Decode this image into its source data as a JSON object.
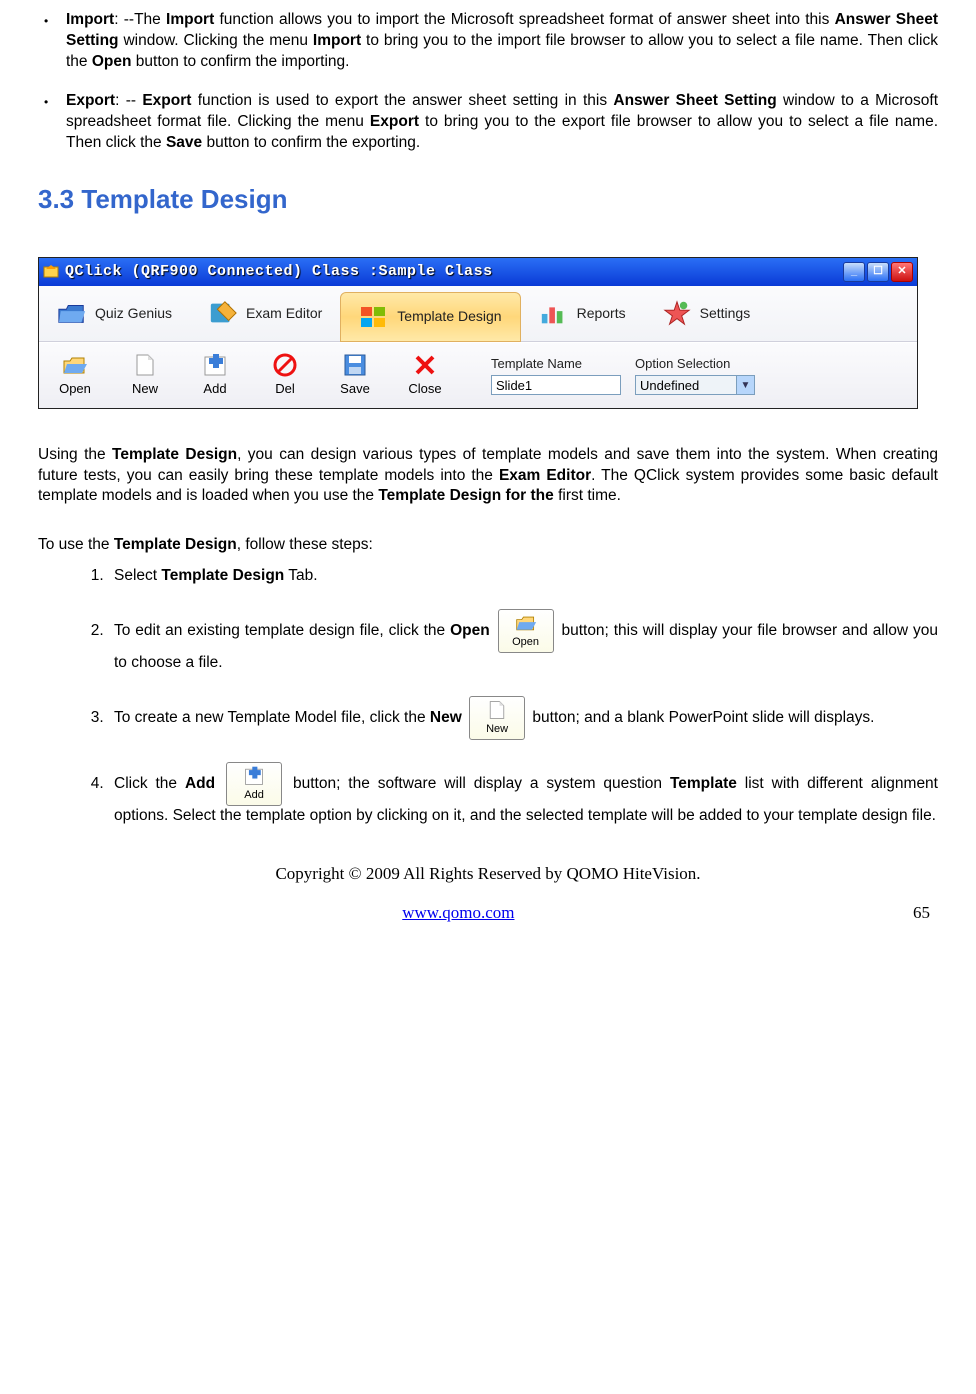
{
  "bullets": [
    {
      "label": "Import",
      "text": ": --The Import function allows you to import the Microsoft spreadsheet format of answer sheet into this Answer Sheet Setting window. Clicking the menu Import to bring you to the import file browser to allow you to select a file name. Then click the Open button to confirm the importing."
    },
    {
      "label": "Export",
      "text": ": -- Export function is used to export the answer sheet setting in this Answer Sheet Setting window to a Microsoft spreadsheet format file. Clicking the menu Export to bring you to the export file browser to allow you to select a file name. Then click the Save button to confirm the exporting."
    }
  ],
  "section_heading": "3.3  Template Design",
  "window": {
    "title": "QClick  (QRF900 Connected)  Class :Sample Class",
    "tabs": [
      "Quiz Genius",
      "Exam Editor",
      "Template Design",
      "Reports",
      "Settings"
    ],
    "toolbar": [
      "Open",
      "New",
      "Add",
      "Del",
      "Save",
      "Close"
    ],
    "template_name_label": "Template Name",
    "template_name_value": "Slide1",
    "option_selection_label": "Option Selection",
    "option_selection_value": "Undefined"
  },
  "intro_para": "Using the Template Design, you can design various types of template models and save them into the system. When creating future tests, you can easily bring these template models into the Exam Editor. The QClick system provides some basic default template models and is loaded when you use the Template Design for the first time.",
  "instr_lead": "To use the Template Design, follow these steps:",
  "steps": [
    "Select Template Design Tab.",
    "To edit an existing template design file, click the Open [BTN] button; this will display your file browser and allow you to choose a file.",
    "To create a new Template Model file, click the New [BTN] button; and a blank PowerPoint slide will displays.",
    "Click the Add [BTN] button; the software will display a system question Template list with different alignment options. Select the template option by clicking on it, and the selected template will be added to your template design file."
  ],
  "inline_buttons": {
    "open": "Open",
    "new": "New",
    "add": "Add"
  },
  "footer_copyright": "Copyright © 2009 All Rights Reserved by QOMO HiteVision.",
  "footer_link": "www.qomo.com",
  "page_number": "65"
}
